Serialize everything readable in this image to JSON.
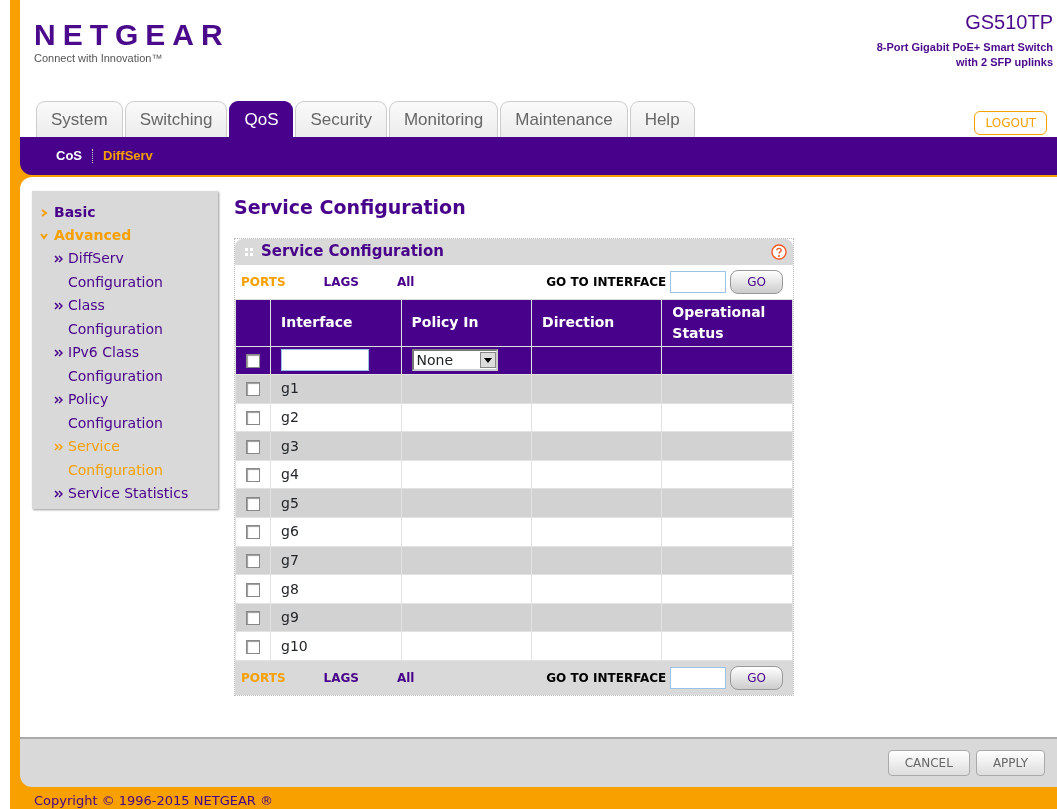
{
  "header": {
    "logo": "NETGEAR",
    "tagline": "Connect with Innovation™",
    "model": "GS510TP",
    "description": [
      "8-Port Gigabit PoE+ Smart Switch",
      "with 2 SFP uplinks"
    ]
  },
  "tabs": [
    {
      "label": "System",
      "selected": false
    },
    {
      "label": "Switching",
      "selected": false
    },
    {
      "label": "QoS",
      "selected": true
    },
    {
      "label": "Security",
      "selected": false
    },
    {
      "label": "Monitoring",
      "selected": false
    },
    {
      "label": "Maintenance",
      "selected": false
    },
    {
      "label": "Help",
      "selected": false
    }
  ],
  "logout": "LOGOUT",
  "subnav": [
    {
      "label": "CoS",
      "selected": false
    },
    {
      "label": "DiffServ",
      "selected": true
    }
  ],
  "sidebar": {
    "items": [
      {
        "label": "Basic",
        "expanded": false
      },
      {
        "label": "Advanced",
        "expanded": true,
        "children": [
          {
            "label": "DiffServ Configuration",
            "selected": false
          },
          {
            "label": "Class Configuration",
            "selected": false
          },
          {
            "label": "IPv6 Class Configuration",
            "selected": false
          },
          {
            "label": "Policy Configuration",
            "selected": false
          },
          {
            "label": "Service Configuration",
            "selected": true
          },
          {
            "label": "Service Statistics",
            "selected": false
          }
        ]
      }
    ]
  },
  "page_title": "Service Configuration",
  "panel": {
    "title": "Service Configuration",
    "top_bar": {
      "filters": [
        {
          "label": "PORTS",
          "selected": true
        },
        {
          "label": "LAGS",
          "selected": false
        },
        {
          "label": "All",
          "selected": false
        }
      ],
      "goto_label": "GO TO INTERFACE",
      "go_button": "GO"
    },
    "columns": [
      "Interface",
      "Policy In",
      "Direction",
      "Operational Status"
    ],
    "edit_row": {
      "checked": false,
      "policy": "None"
    },
    "rows": [
      {
        "interface": "g1",
        "checked": false
      },
      {
        "interface": "g2",
        "checked": false
      },
      {
        "interface": "g3",
        "checked": false
      },
      {
        "interface": "g4",
        "checked": false
      },
      {
        "interface": "g5",
        "checked": false
      },
      {
        "interface": "g6",
        "checked": false
      },
      {
        "interface": "g7",
        "checked": false
      },
      {
        "interface": "g8",
        "checked": false
      },
      {
        "interface": "g9",
        "checked": false
      },
      {
        "interface": "g10",
        "checked": false
      }
    ],
    "bottom_bar": {
      "filters": [
        {
          "label": "PORTS",
          "selected": true
        },
        {
          "label": "LAGS",
          "selected": false
        },
        {
          "label": "All",
          "selected": false
        }
      ],
      "goto_label": "GO TO INTERFACE",
      "go_button": "GO"
    }
  },
  "buttons": [
    "CANCEL",
    "APPLY"
  ],
  "copyright": "Copyright © 1996-2015 NETGEAR ®"
}
